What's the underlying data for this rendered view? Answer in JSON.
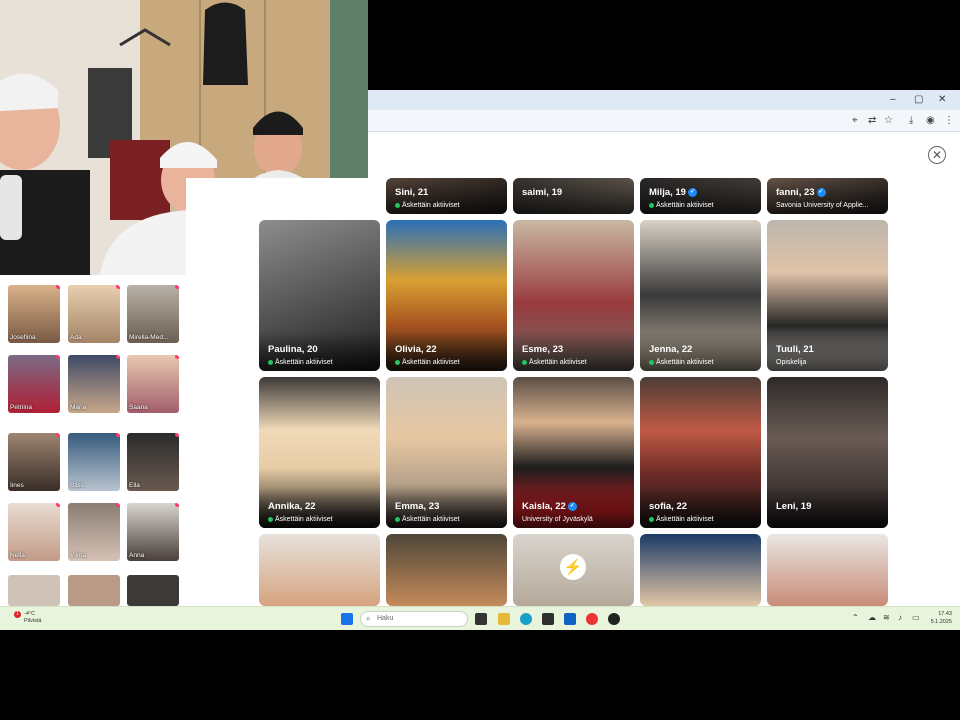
{
  "browser": {
    "window_controls": [
      "–",
      "▢",
      "✕"
    ],
    "close_dialog_label": "✕"
  },
  "cards": [
    {
      "name": "Sini, 21",
      "status": "Äskettäin aktiiviset",
      "active": true,
      "verified": false
    },
    {
      "name": "saimi, 19",
      "status": "",
      "active": false,
      "verified": false
    },
    {
      "name": "Milja, 19",
      "status": "Äskettäin aktiiviset",
      "active": true,
      "verified": true
    },
    {
      "name": "fanni, 23",
      "status": "Savonia University of Applie...",
      "active": false,
      "verified": true
    },
    {
      "name": "Paulina, 20",
      "status": "Äskettäin aktiiviset",
      "active": true,
      "verified": false
    },
    {
      "name": "Olivia, 22",
      "status": "Äskettäin aktiiviset",
      "active": true,
      "verified": false
    },
    {
      "name": "Esme, 23",
      "status": "Äskettäin aktiiviset",
      "active": true,
      "verified": false
    },
    {
      "name": "Jenna, 22",
      "status": "Äskettäin aktiiviset",
      "active": true,
      "verified": false
    },
    {
      "name": "Tuuli, 21",
      "status": "Opiskelija",
      "active": false,
      "verified": false
    },
    {
      "name": "Annika, 22",
      "status": "Äskettäin aktiiviset",
      "active": true,
      "verified": false
    },
    {
      "name": "Emma, 23",
      "status": "Äskettäin aktiiviset",
      "active": true,
      "verified": false
    },
    {
      "name": "Kaisla, 22",
      "status": "University of Jyväskylä",
      "active": false,
      "verified": true
    },
    {
      "name": "sofia, 22",
      "status": "Äskettäin aktiiviset",
      "active": true,
      "verified": false
    },
    {
      "name": "Leni, 19",
      "status": "",
      "active": false,
      "verified": false
    }
  ],
  "left_thumbs": [
    {
      "label": "Josefiina"
    },
    {
      "label": "Ada"
    },
    {
      "label": "Mirella-Med..."
    },
    {
      "label": "Petriina"
    },
    {
      "label": "Maria"
    },
    {
      "label": "Saana"
    },
    {
      "label": "Iines"
    },
    {
      "label": "Bliss"
    },
    {
      "label": "Ella"
    },
    {
      "label": "Nella"
    },
    {
      "label": "Viima"
    },
    {
      "label": "Anna"
    }
  ],
  "taskbar": {
    "search_placeholder": "Haku",
    "notification_count": "1",
    "weather_line1": "-4°C",
    "weather_line2": "Pilvistä",
    "time": "17.43",
    "date": "5.1.2025"
  },
  "colors": {
    "active_dot": "#22c55e",
    "verified": "#1d8cf8",
    "notify_dot": "#ff3b6b",
    "taskbar": "#e9f4dc"
  }
}
